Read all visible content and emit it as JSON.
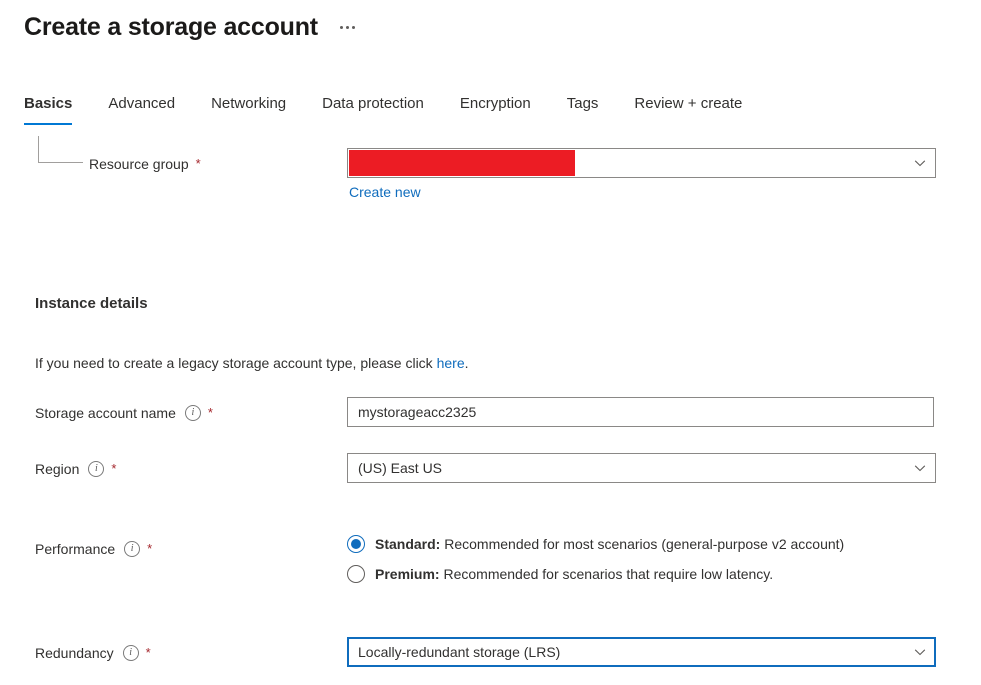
{
  "header": {
    "title": "Create a storage account",
    "more_menu_label": "More options",
    "more_menu_icon": "ellipsis-horizontal-icon"
  },
  "tabs": [
    {
      "label": "Basics",
      "active": true
    },
    {
      "label": "Advanced",
      "active": false
    },
    {
      "label": "Networking",
      "active": false
    },
    {
      "label": "Data protection",
      "active": false
    },
    {
      "label": "Encryption",
      "active": false
    },
    {
      "label": "Tags",
      "active": false
    },
    {
      "label": "Review + create",
      "active": false
    }
  ],
  "project_details": {
    "resource_group": {
      "label": "Resource group",
      "required_marker": "*",
      "value": "",
      "redacted": true,
      "redaction_color": "#ec1c24",
      "chevron_icon": "chevron-down-icon",
      "create_new_link": "Create new"
    }
  },
  "instance_details": {
    "section_title": "Instance details",
    "legacy_note_prefix": "If you need to create a legacy storage account type, please click ",
    "legacy_note_link": "here",
    "legacy_note_suffix": ".",
    "storage_account_name": {
      "label": "Storage account name",
      "info_icon": "info-icon",
      "required_marker": "*",
      "value": "mystorageacc2325",
      "placeholder": ""
    },
    "region": {
      "label": "Region",
      "info_icon": "info-icon",
      "required_marker": "*",
      "value": "(US) East US",
      "chevron_icon": "chevron-down-icon"
    },
    "performance": {
      "label": "Performance",
      "info_icon": "info-icon",
      "required_marker": "*",
      "options": [
        {
          "name_bold": "Standard:",
          "description": " Recommended for most scenarios (general-purpose v2 account)",
          "selected": true
        },
        {
          "name_bold": "Premium:",
          "description": " Recommended for scenarios that require low latency.",
          "selected": false
        }
      ]
    },
    "redundancy": {
      "label": "Redundancy",
      "info_icon": "info-icon",
      "required_marker": "*",
      "value": "Locally-redundant storage (LRS)",
      "chevron_icon": "chevron-down-icon",
      "focused": true
    }
  },
  "colors": {
    "accent": "#0078d4",
    "focus_border": "#0f6cbd",
    "link": "#0f6cbd",
    "required": "#a4262c",
    "redaction": "#ec1c24",
    "text": "#323130"
  }
}
